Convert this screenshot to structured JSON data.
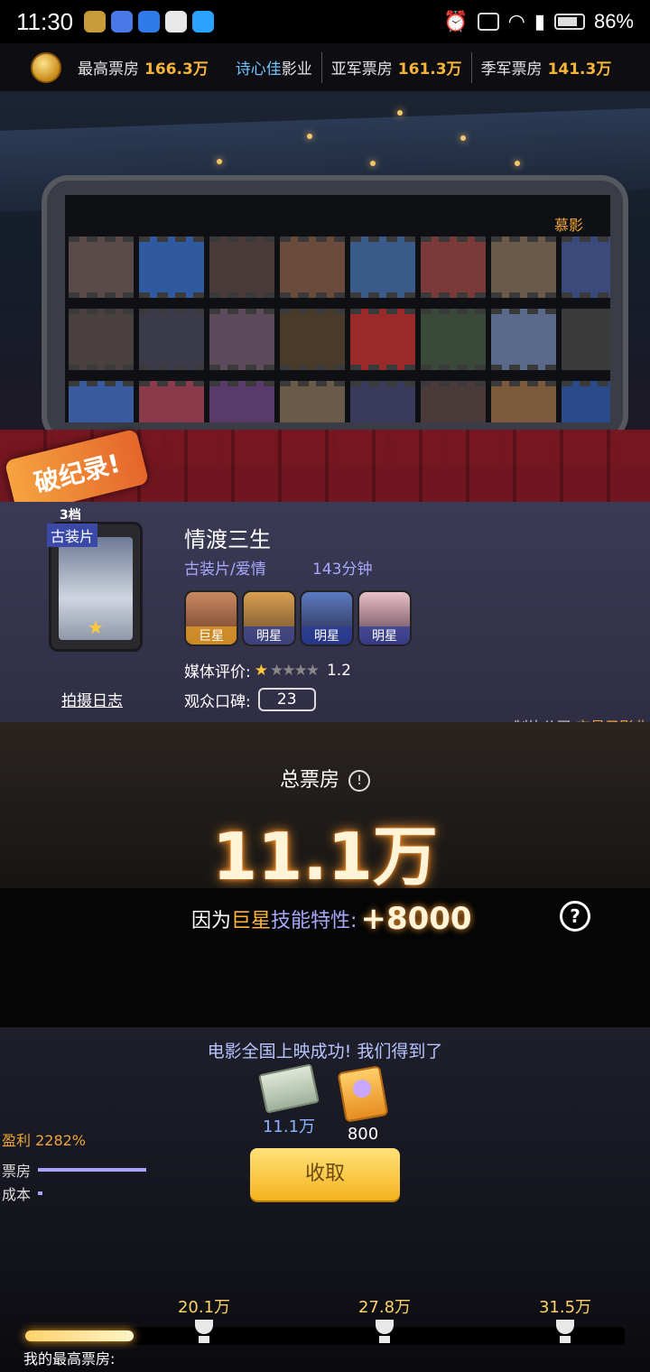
{
  "status_bar": {
    "time": "11:30",
    "battery": "86%"
  },
  "ranking_bar": {
    "top_label": "最高票房",
    "top_value": "166.3万",
    "studio_name": "诗心佳",
    "studio_suffix": "影业",
    "second_label": "亚军票房",
    "second_value": "161.3万",
    "third_label": "季军票房",
    "third_value": "141.3万"
  },
  "theater": {
    "screen_tag": "慕影"
  },
  "record_badge": "破纪录!",
  "movie": {
    "grade": "3档",
    "genre_tag": "古装片",
    "title": "情渡三生",
    "genres": "古装片/爱情",
    "duration": "143分钟",
    "actors": [
      {
        "label": "巨星",
        "tier": "gold"
      },
      {
        "label": "明星",
        "tier": "blue"
      },
      {
        "label": "明星",
        "tier": "blue"
      },
      {
        "label": "明星",
        "tier": "blue"
      }
    ],
    "media_rating_label": "媒体评价:",
    "media_rating_value": "1.2",
    "media_rating_stars": 0.5,
    "audience_label": "观众口碑:",
    "audience_value": "23",
    "shoot_log": "拍摄日志",
    "producer_label": "制片公司:",
    "producer_value": "玄易子影业"
  },
  "box_office": {
    "label": "总票房",
    "value": "11.1万",
    "bonus_prefix": "因为",
    "bonus_highlight": "巨星",
    "bonus_suffix": "技能特性:",
    "bonus_amount": "+8000"
  },
  "reward": {
    "title": "电影全国上映成功! 我们得到了",
    "items": [
      {
        "icon": "money-stack-icon",
        "value": "11.1万"
      },
      {
        "icon": "card-icon",
        "value": "800"
      }
    ],
    "profit": "盈利 2282%",
    "revenue_label": "票房",
    "cost_label": "成本",
    "revenue_ratio": 1.0,
    "cost_ratio": 0.044,
    "collect_button": "收取"
  },
  "milestones": {
    "items": [
      "20.1万",
      "27.8万",
      "31.5万"
    ],
    "progress": 0.18,
    "my_best_label": "我的最高票房:"
  }
}
